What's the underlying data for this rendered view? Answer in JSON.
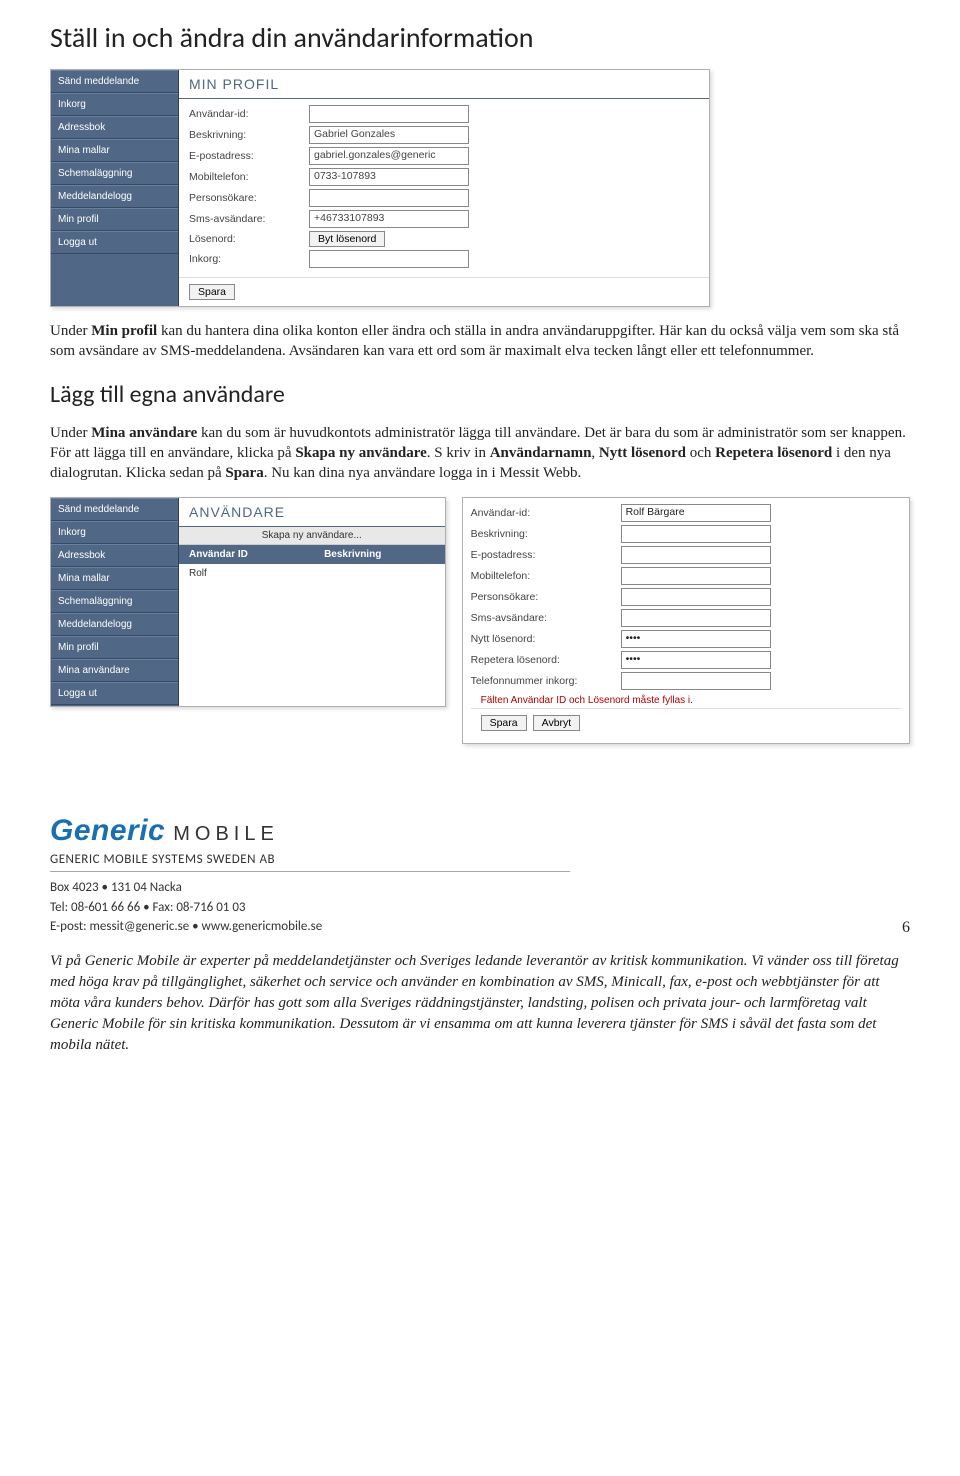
{
  "h1": "Ställ in och ändra din användarinformation",
  "profile_screenshot": {
    "sidebar": [
      "Sänd meddelande",
      "Inkorg",
      "Adressbok",
      "Mina mallar",
      "Schemaläggning",
      "Meddelandelogg",
      "Min profil",
      "Logga ut"
    ],
    "title": "MIN PROFIL",
    "fields": [
      {
        "label": "Användar-id:",
        "value": ""
      },
      {
        "label": "Beskrivning:",
        "value": "Gabriel Gonzales"
      },
      {
        "label": "E-postadress:",
        "value": "gabriel.gonzales@generic"
      },
      {
        "label": "Mobiltelefon:",
        "value": "0733-107893"
      },
      {
        "label": "Personsökare:",
        "value": ""
      },
      {
        "label": "Sms-avsändare:",
        "value": "+46733107893"
      },
      {
        "label": "Lösenord:",
        "button": "Byt lösenord"
      },
      {
        "label": "Inkorg:",
        "value": ""
      }
    ],
    "save": "Spara"
  },
  "para1_pre": "Under ",
  "para1_b1": "Min profil",
  "para1_post": " kan du hantera dina olika konton eller ändra och ställa in andra användaruppgifter. Här kan du också välja vem som ska stå som avsändare av SMS-meddelandena. Avsändaren kan vara ett ord som är maximalt elva tecken långt eller ett telefonnummer.",
  "h2": "Lägg till egna användare",
  "para2_parts": {
    "a": "Under ",
    "b1": "Mina användare",
    "b": " kan du som är huvudkontots administratör lägga till användare. Det är bara du som är administratör som ser knappen. För att lägga till en användare, klicka på ",
    "b2": "Skapa ny användare",
    "c": ". S kriv in ",
    "b3": "Användarnamn",
    "d": ", ",
    "b4": "Nytt lösenord",
    "e": " och ",
    "b5": "Repetera lösenord",
    "f": " i den nya dialogrutan. Klicka sedan på ",
    "b6": "Spara",
    "g": ". Nu kan dina nya användare logga in i Messit Webb."
  },
  "users_screenshot": {
    "sidebar": [
      "Sänd meddelande",
      "Inkorg",
      "Adressbok",
      "Mina mallar",
      "Schemaläggning",
      "Meddelandelogg",
      "Min profil",
      "Mina användare",
      "Logga ut"
    ],
    "title": "ANVÄNDARE",
    "subbar": "Skapa ny användare...",
    "col1": "Användar ID",
    "col2": "Beskrivning",
    "row1": "Rolf"
  },
  "user_form": {
    "fields": [
      {
        "label": "Användar-id:",
        "value": "Rolf Bärgare"
      },
      {
        "label": "Beskrivning:",
        "value": ""
      },
      {
        "label": "E-postadress:",
        "value": ""
      },
      {
        "label": "Mobiltelefon:",
        "value": ""
      },
      {
        "label": "Personsökare:",
        "value": ""
      },
      {
        "label": "Sms-avsändare:",
        "value": ""
      },
      {
        "label": "Nytt lösenord:",
        "value": "••••"
      },
      {
        "label": "Repetera lösenord:",
        "value": "••••"
      },
      {
        "label": "Telefonnummer inkorg:",
        "value": ""
      }
    ],
    "hint": "Fälten Användar ID och Lösenord måste fyllas i.",
    "save": "Spara",
    "cancel": "Avbryt"
  },
  "footer": {
    "logo1": "Generic",
    "logo2": "MOBILE",
    "company": "GENERIC MOBILE SYSTEMS SWEDEN AB",
    "addr": "Box 4023 • 131 04 Nacka",
    "tel": "Tel: 08-601 66 66 • Fax: 08-716 01 03",
    "mail": "E-post: messit@generic.se • www.genericmobile.se",
    "page": "6",
    "about": "Vi på Generic Mobile är experter på meddelandetjänster och Sveriges ledande leverantör av kritisk kommunikation. Vi vänder oss till företag med höga krav på tillgänglighet, säkerhet och service och använder en kombination av SMS, Minicall, fax, e-post och webbtjänster för att möta våra kunders behov. Därför has gott som alla Sveriges räddningstjänster, landsting, polisen och privata jour- och larmföretag valt Generic Mobile för sin kritiska kommunikation. Dessutom är vi ensamma om att kunna leverera tjänster för SMS i såväl det fasta som det mobila nätet."
  }
}
